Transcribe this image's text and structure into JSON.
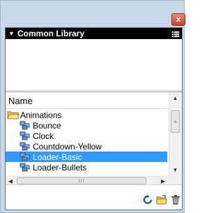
{
  "window": {
    "close_glyph": "x"
  },
  "panel": {
    "title": "Common Library",
    "collapse_glyph": "▼",
    "menu_icon": "panel-menu-icon"
  },
  "list": {
    "column_header": "Name",
    "rows": [
      {
        "label": "Animations",
        "icon": "folder-icon",
        "level": 0,
        "selected": false
      },
      {
        "label": "Bounce",
        "icon": "symbol-icon",
        "level": 1,
        "selected": false
      },
      {
        "label": "Clock",
        "icon": "symbol-icon",
        "level": 1,
        "selected": false
      },
      {
        "label": "Countdown-Yellow",
        "icon": "symbol-icon",
        "level": 1,
        "selected": false
      },
      {
        "label": "Loader-Basic",
        "icon": "symbol-icon",
        "level": 1,
        "selected": true
      },
      {
        "label": "Loader-Bullets",
        "icon": "symbol-icon",
        "level": 1,
        "selected": false
      }
    ],
    "vscroll": {
      "up": "▲",
      "down": "▼",
      "thumb_grip": "≡"
    },
    "hscroll": {
      "left": "◀",
      "right": "▶",
      "thumb_grip": "III"
    }
  },
  "toolbar": {
    "buttons": [
      "refresh-icon",
      "import-folder-icon",
      "trash-icon"
    ]
  },
  "colors": {
    "selection": "#3399ff",
    "header_bg": "#000000",
    "chrome": "#c9d8ea"
  }
}
